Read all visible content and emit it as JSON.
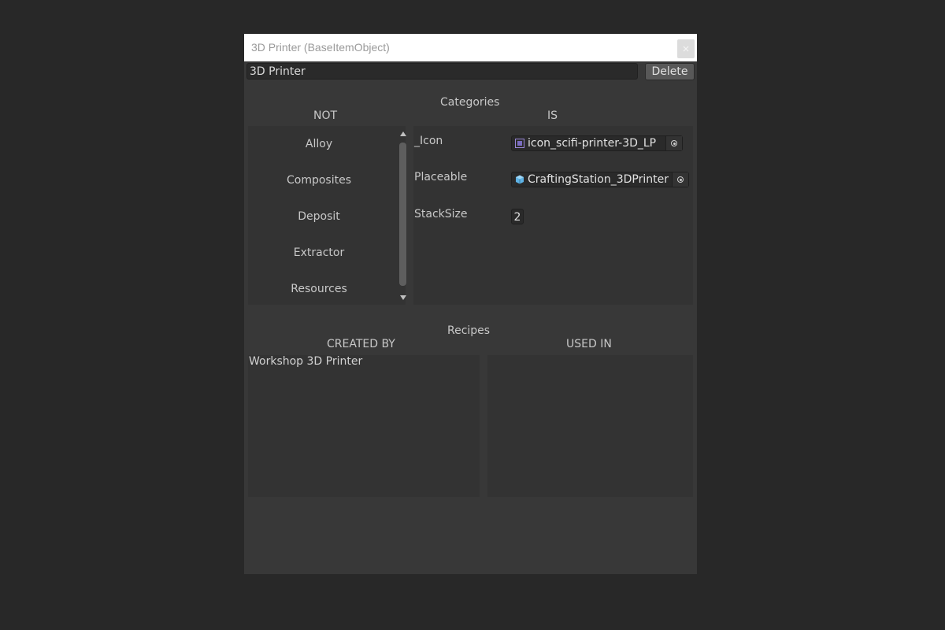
{
  "window": {
    "title": "3D Printer (BaseItemObject)",
    "close_icon": "close-icon"
  },
  "item": {
    "name_value": "3D Printer",
    "delete_label": "Delete"
  },
  "categories": {
    "title": "Categories",
    "not_header": "NOT",
    "is_header": "IS",
    "not_items": [
      "Alloy",
      "Composites",
      "Deposit",
      "Extractor",
      "Resources"
    ]
  },
  "properties": {
    "icon": {
      "label": "_Icon",
      "value": "icon_scifi-printer-3D_LP",
      "icon": "sprite-icon"
    },
    "placeable": {
      "label": "Placeable",
      "value": "CraftingStation_3DPrinter",
      "icon": "prefab-cube-icon"
    },
    "stack_size": {
      "label": "StackSize",
      "value": "2"
    }
  },
  "recipes": {
    "title": "Recipes",
    "created_by_header": "CREATED BY",
    "used_in_header": "USED IN",
    "created_by": [
      "Workshop 3D Printer"
    ],
    "used_in": []
  },
  "colors": {
    "background": "#282828",
    "window": "#383838",
    "panel": "#333333",
    "titlebar": "#ffffff"
  }
}
